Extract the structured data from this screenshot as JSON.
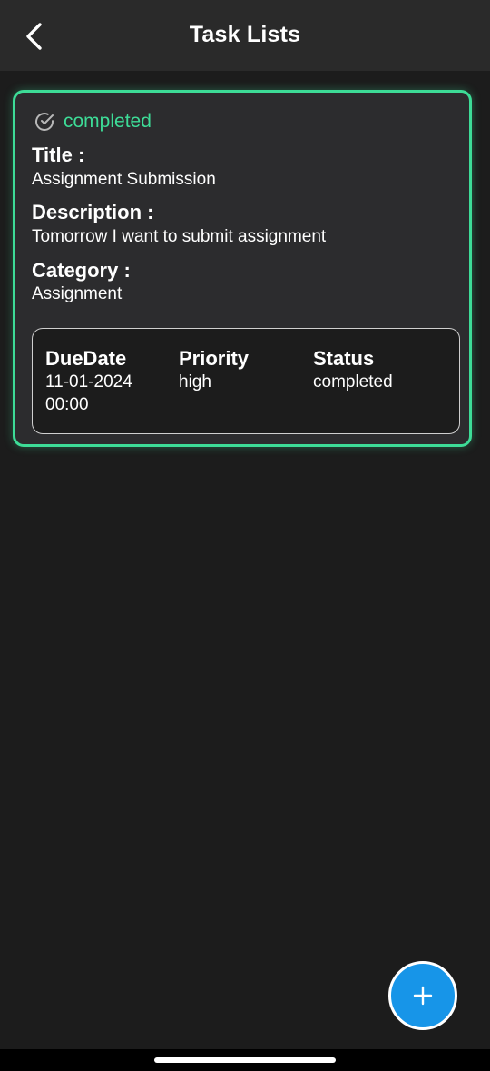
{
  "app_bar": {
    "title": "Task Lists",
    "back_icon": "chevron-left-icon"
  },
  "task": {
    "status_badge": "completed",
    "status_icon": "check-circle-icon",
    "title_label": "Title :",
    "title_value": "Assignment Submission",
    "description_label": "Description :",
    "description_value": "Tomorrow I want to submit assignment",
    "category_label": "Category :",
    "category_value": "Assignment",
    "details": {
      "due_date_label": "DueDate",
      "due_date_value": "11-01-2024",
      "due_time_value": "00:00",
      "priority_label": "Priority",
      "priority_value": "high",
      "status_label": "Status",
      "status_value": "completed"
    }
  },
  "fab": {
    "icon": "plus-icon"
  },
  "colors": {
    "accent_green": "#3ddc97",
    "fab_blue": "#1795e8",
    "background": "#1c1c1c",
    "card": "#2c2c2e"
  }
}
